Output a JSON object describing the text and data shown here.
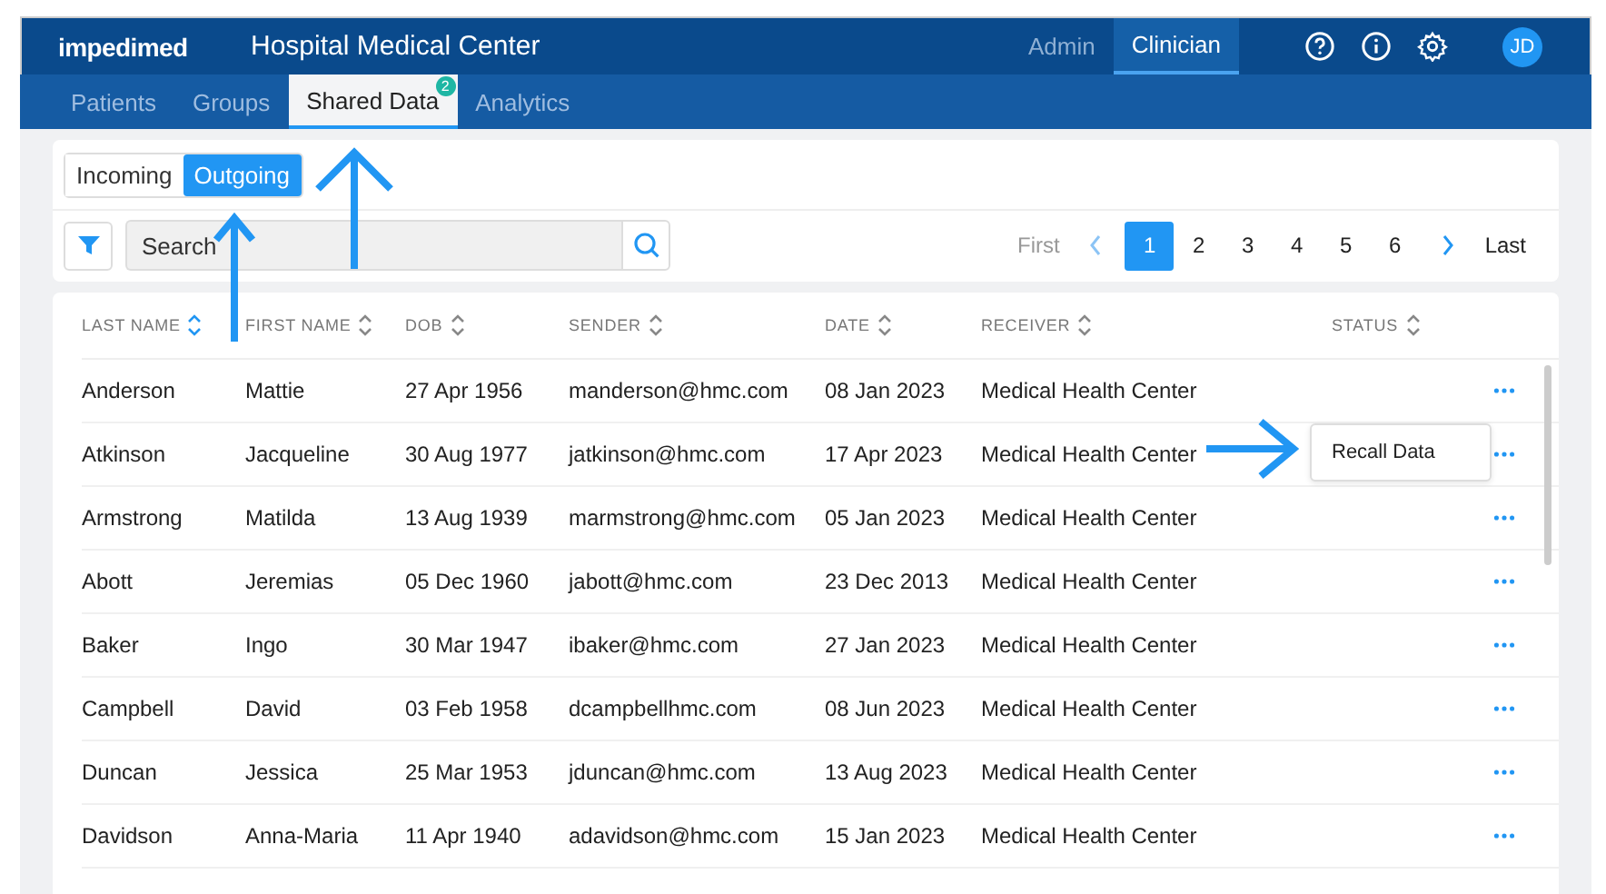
{
  "header": {
    "logo": "impedimed",
    "title": "Hospital Medical Center",
    "roles": [
      {
        "label": "Admin",
        "selected": false
      },
      {
        "label": "Clinician",
        "selected": true
      }
    ],
    "avatar": "JD"
  },
  "nav": [
    {
      "label": "Patients",
      "selected": false
    },
    {
      "label": "Groups",
      "selected": false
    },
    {
      "label": "Shared Data",
      "selected": true,
      "badge": "2"
    },
    {
      "label": "Analytics",
      "selected": false
    }
  ],
  "toggle": [
    {
      "label": "Incoming",
      "selected": false
    },
    {
      "label": "Outgoing",
      "selected": true
    }
  ],
  "search": {
    "placeholder": "Search"
  },
  "pagination": {
    "first": "First",
    "last": "Last",
    "pages": [
      {
        "label": "1",
        "selected": true
      },
      {
        "label": "2",
        "selected": false
      },
      {
        "label": "3",
        "selected": false
      },
      {
        "label": "4",
        "selected": false
      },
      {
        "label": "5",
        "selected": false
      },
      {
        "label": "6",
        "selected": false
      }
    ]
  },
  "table": {
    "columns": [
      "LAST NAME",
      "FIRST NAME",
      "DOB",
      "SENDER",
      "DATE",
      "RECEIVER",
      "STATUS"
    ],
    "rows": [
      {
        "cells": [
          "Anderson",
          "Mattie",
          "27 Apr 1956",
          "manderson@hmc.com",
          "08 Jan 2023",
          "Medical Health Center"
        ]
      },
      {
        "cells": [
          "Atkinson",
          "Jacqueline",
          "30 Aug 1977",
          "jatkinson@hmc.com",
          "17 Apr 2023",
          "Medical Health Center"
        ],
        "menu": [
          "Recall Data"
        ]
      },
      {
        "cells": [
          "Armstrong",
          "Matilda",
          "13 Aug 1939",
          "marmstrong@hmc.com",
          "05 Jan 2023",
          "Medical Health Center"
        ]
      },
      {
        "cells": [
          "Abott",
          "Jeremias",
          "05 Dec 1960",
          "jabott@hmc.com",
          "23 Dec 2013",
          "Medical Health Center"
        ]
      },
      {
        "cells": [
          "Baker",
          "Ingo",
          "30 Mar 1947",
          "ibaker@hmc.com",
          "27 Jan 2023",
          "Medical Health Center"
        ]
      },
      {
        "cells": [
          "Campbell",
          "David",
          "03 Feb 1958",
          "dcampbellhmc.com",
          "08 Jun 2023",
          "Medical Health Center"
        ]
      },
      {
        "cells": [
          "Duncan",
          "Jessica",
          "25 Mar 1953",
          "jduncan@hmc.com",
          "13 Aug 2023",
          "Medical Health Center"
        ]
      },
      {
        "cells": [
          "Davidson",
          "Anna-Maria",
          "11 Apr 1940",
          "adavidson@hmc.com",
          "15 Jan 2023",
          "Medical Health Center"
        ]
      }
    ]
  }
}
